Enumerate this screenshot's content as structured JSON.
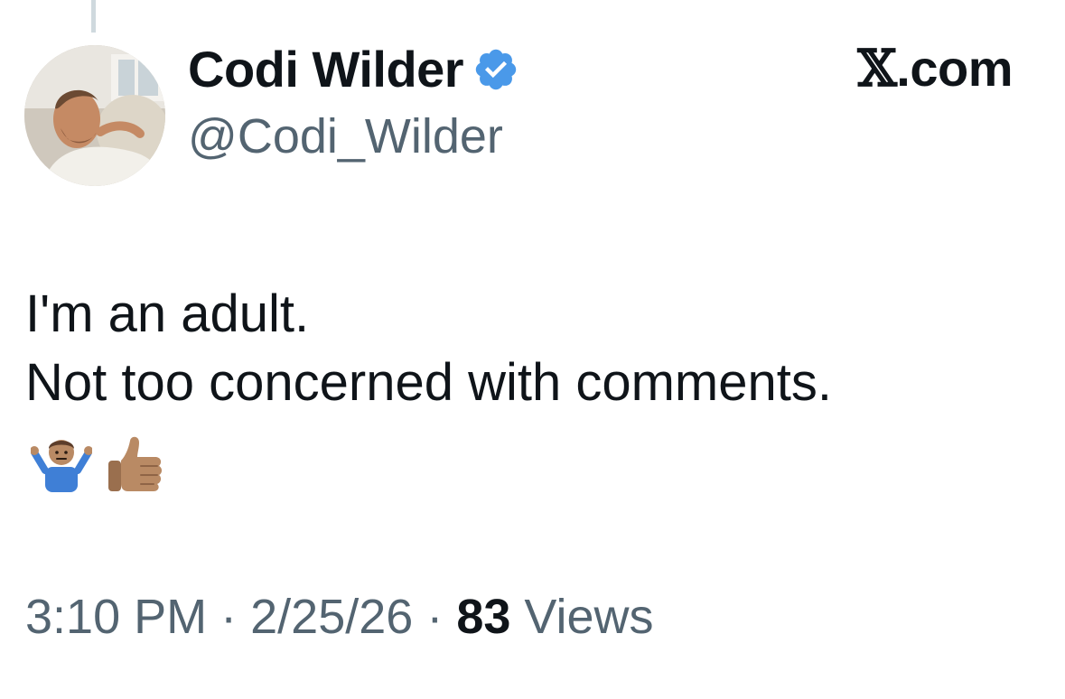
{
  "author": {
    "display_name": "Codi Wilder",
    "handle": "@Codi_Wilder",
    "verified": true,
    "verified_color": "#4a99e9"
  },
  "brand": {
    "label": "X.com"
  },
  "tweet": {
    "lines": [
      "I'm an adult.",
      "Not too concerned with comments."
    ],
    "emojis": [
      "person-shrugging-emoji",
      "thumbs-up-emoji"
    ]
  },
  "meta": {
    "time": "3:10 PM",
    "separator": "·",
    "date": "2/25/26",
    "views_count": "83",
    "views_label": "Views"
  },
  "colors": {
    "text_primary": "#0f1419",
    "text_secondary": "#536471",
    "thread_line": "#cfd9de"
  }
}
